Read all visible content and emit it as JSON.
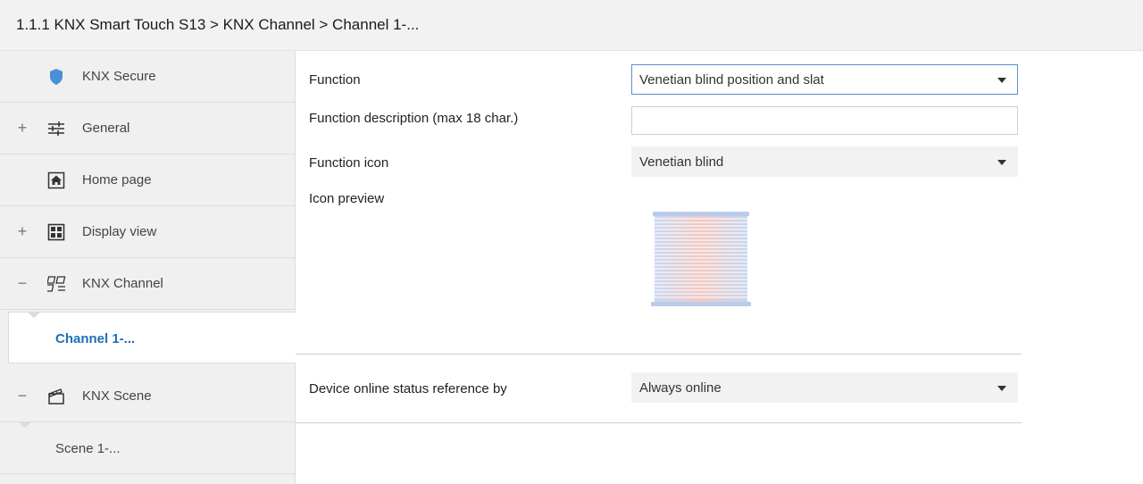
{
  "breadcrumb": "1.1.1 KNX Smart Touch S13 > KNX Channel  > Channel 1-...",
  "sidebar": {
    "items": [
      {
        "label": "KNX Secure",
        "toggle": "",
        "icon": "shield-icon"
      },
      {
        "label": "General",
        "toggle": "+",
        "icon": "sliders-icon"
      },
      {
        "label": "Home page",
        "toggle": "",
        "icon": "home-icon"
      },
      {
        "label": "Display view",
        "toggle": "+",
        "icon": "grid-icon"
      },
      {
        "label": "KNX Channel",
        "toggle": "−",
        "icon": "channel-icon"
      },
      {
        "label": "KNX Scene",
        "toggle": "−",
        "icon": "scene-icon"
      }
    ],
    "sub_channel": "Channel 1-...",
    "sub_scene": "Scene 1-..."
  },
  "form": {
    "function_label": "Function",
    "function_value": "Venetian blind position and slat",
    "description_label": "Function description (max 18 char.)",
    "description_value": "",
    "icon_label": "Function icon",
    "icon_value": "Venetian blind",
    "preview_label": "Icon preview",
    "online_label": "Device online status reference by",
    "online_value": "Always online"
  },
  "colors": {
    "accent": "#1f6fb5",
    "shield": "#4a90d9",
    "focus_border": "#5a8fc9"
  }
}
